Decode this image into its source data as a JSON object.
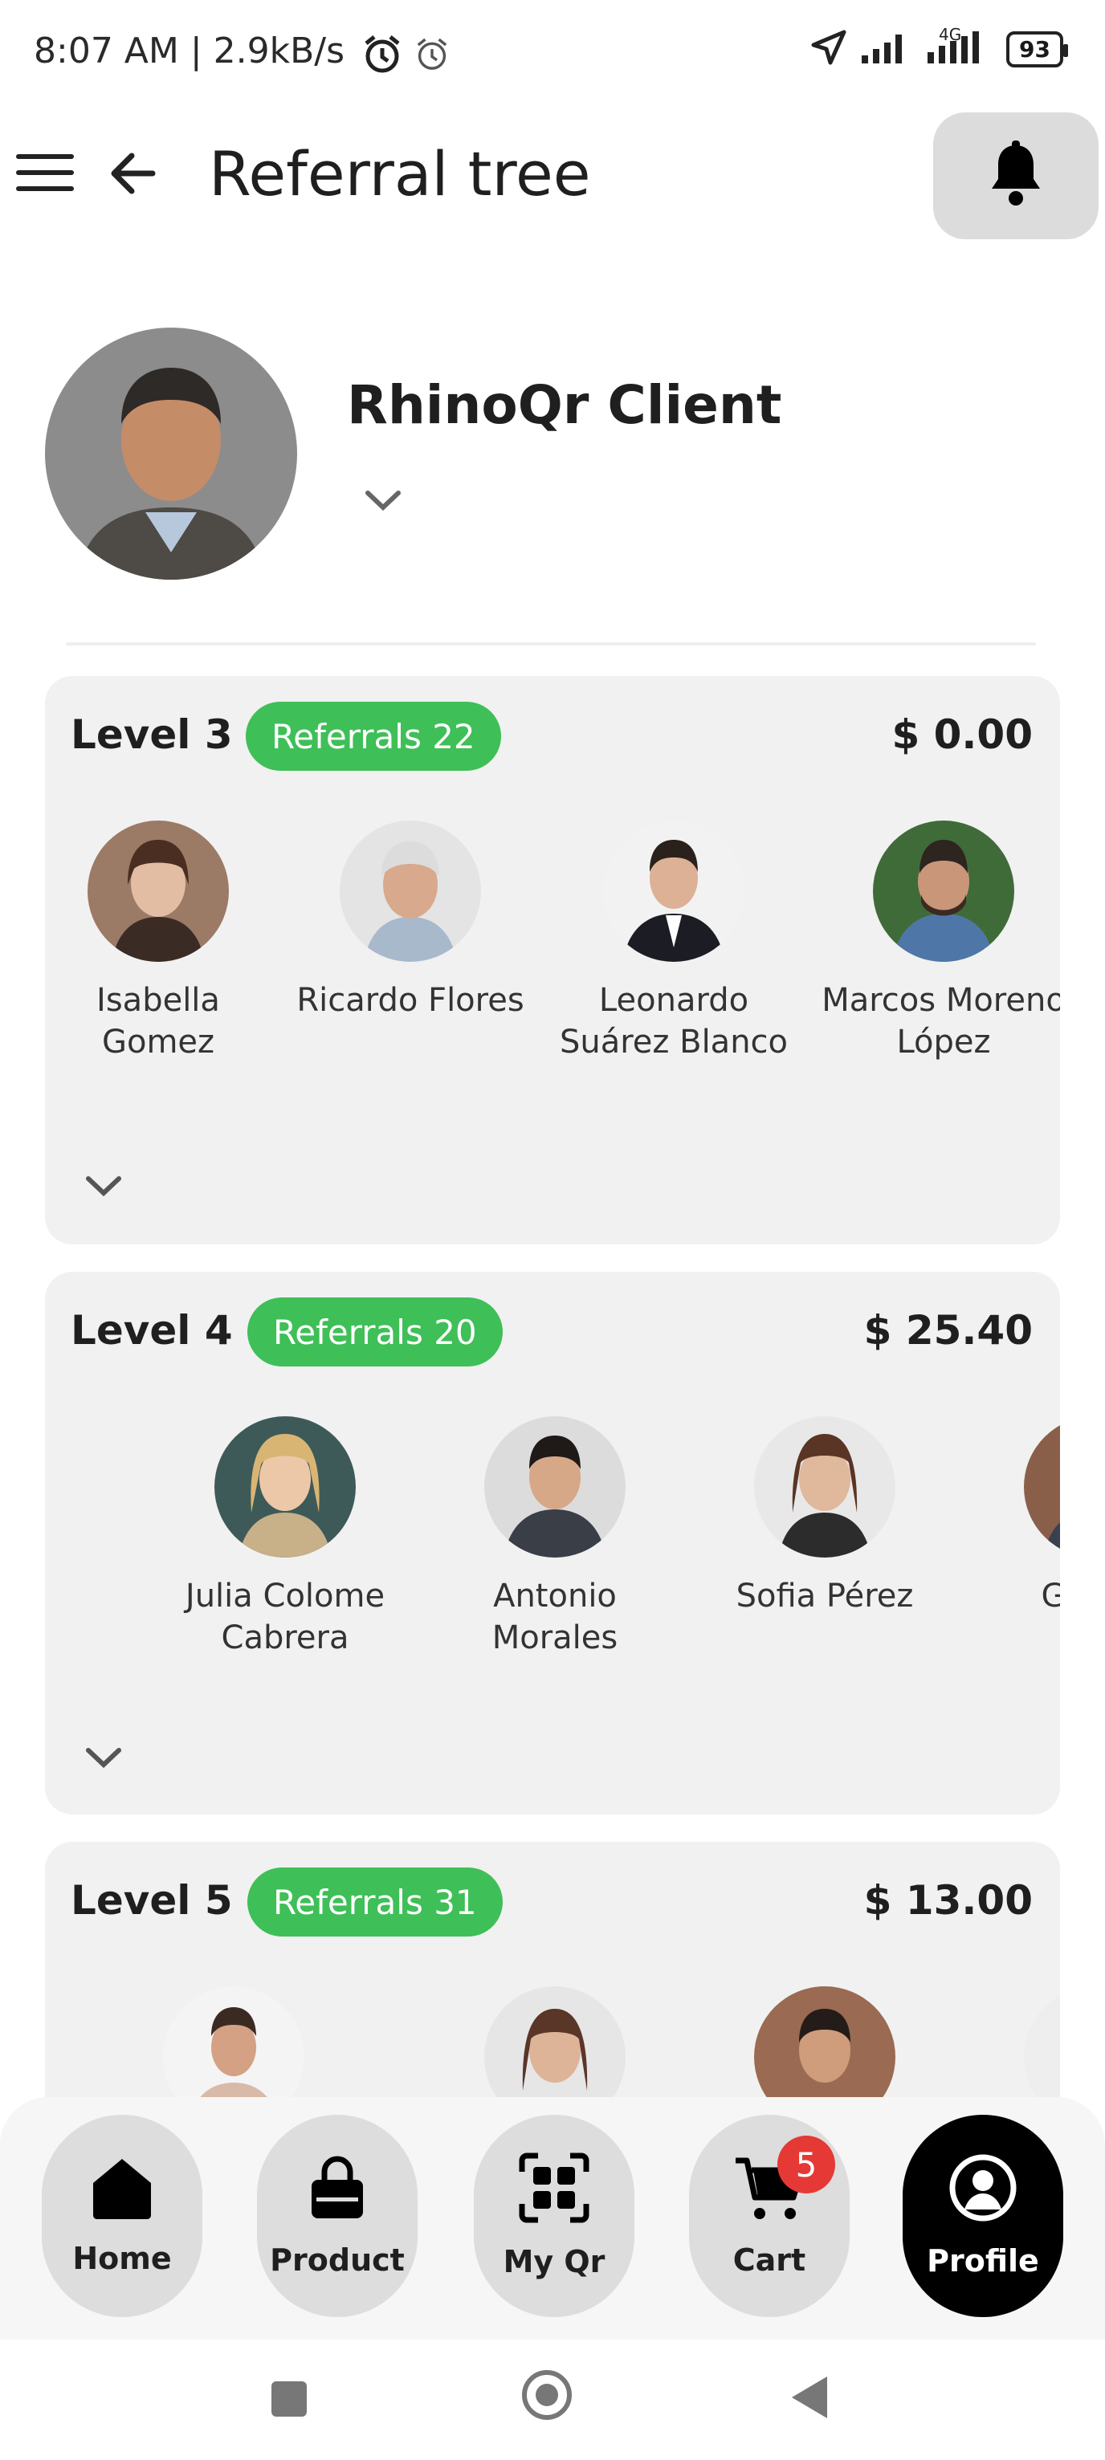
{
  "status_bar": {
    "time": "8:07 AM | 2.9kB/s",
    "network": "4G",
    "battery": "93"
  },
  "header": {
    "title": "Referral tree"
  },
  "client": {
    "name": "RhinoQr Client"
  },
  "levels": [
    {
      "label": "Level 3",
      "referrals": "Referrals 22",
      "amount": "$ 0.00",
      "people": [
        "Isabella\nGomez",
        "Ricardo Flores",
        "Leonardo\nSuárez Blanco",
        "Marcos Moreno\nLópez"
      ]
    },
    {
      "label": "Level 4",
      "referrals": "Referrals 20",
      "amount": "$ 25.40",
      "people": [
        "Julia Colome\nCabrera",
        "Antonio\nMorales",
        "Sofia Pérez",
        "Gabrie\nRuiz"
      ]
    },
    {
      "label": "Level 5",
      "referrals": "Referrals 31",
      "amount": "$ 13.00",
      "people": [
        "",
        "",
        "",
        ""
      ]
    }
  ],
  "bottom_nav": {
    "items": [
      {
        "label": "Home",
        "icon": "home-icon"
      },
      {
        "label": "Product",
        "icon": "bag-icon"
      },
      {
        "label": "My Qr",
        "icon": "qr-icon"
      },
      {
        "label": "Cart",
        "icon": "cart-icon",
        "badge": "5"
      },
      {
        "label": "Profile",
        "icon": "profile-icon",
        "active": true
      }
    ]
  },
  "colors": {
    "accent_green": "#3fbf57",
    "badge_red": "#e53935",
    "active_nav": "#000000"
  }
}
